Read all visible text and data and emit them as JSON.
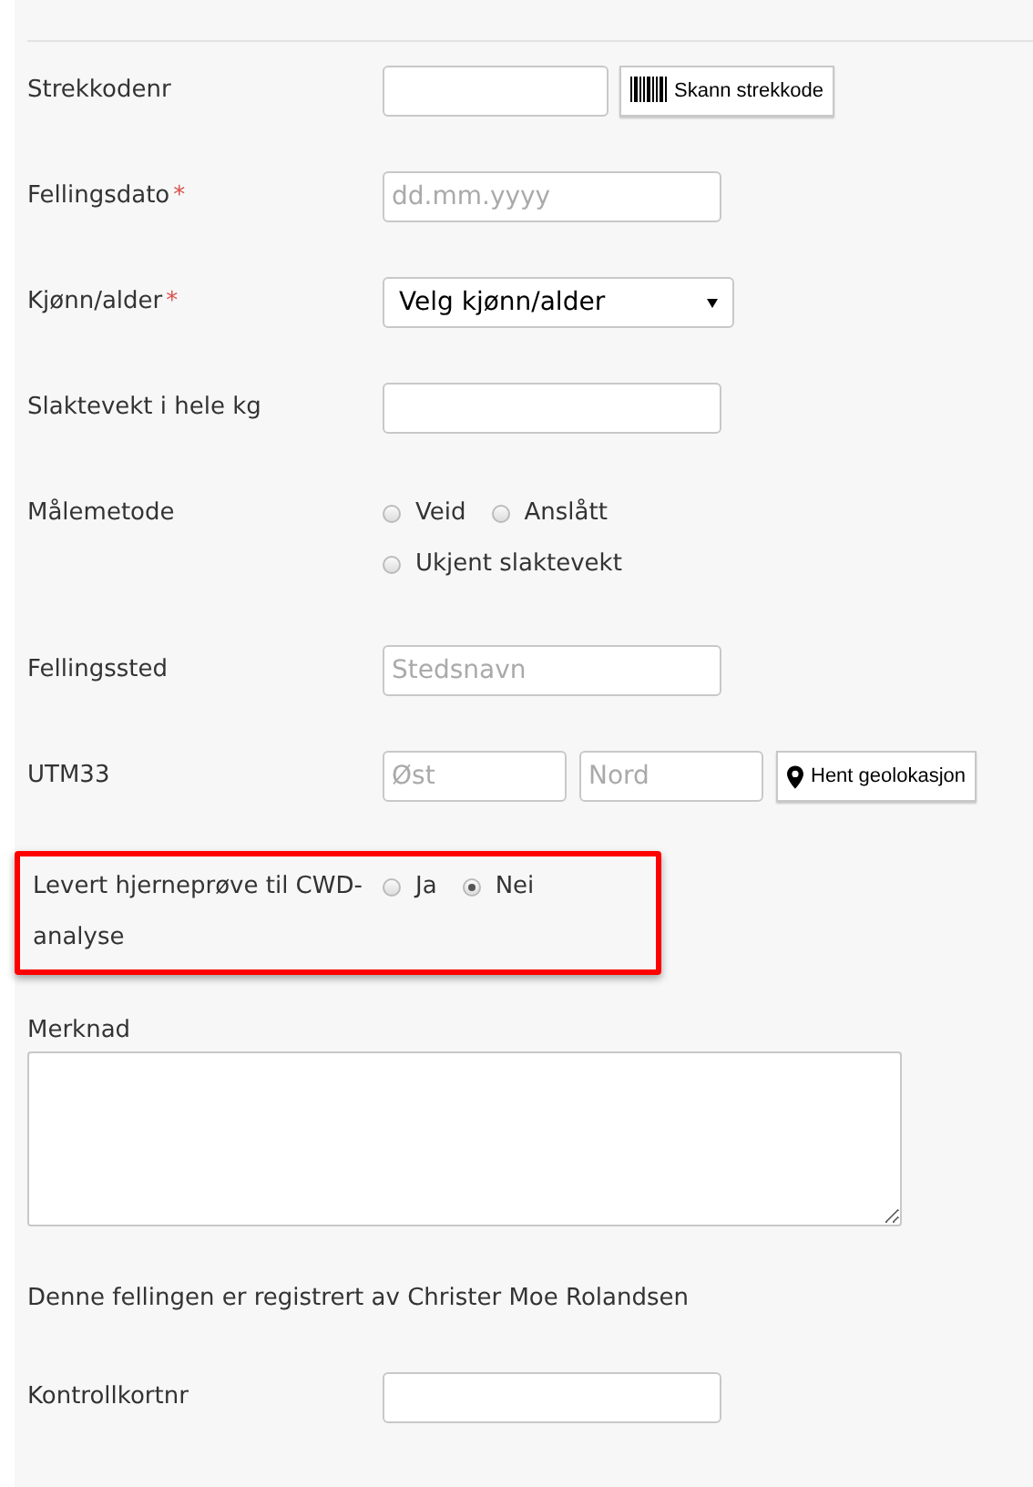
{
  "fields": [
    {
      "kind": "text",
      "label": "Strekkodenr",
      "button": "Skann strekkode"
    },
    {
      "kind": "text",
      "label": "Fellingsdato",
      "required_mark": "*",
      "placeholder": "dd.mm.yyyy"
    },
    {
      "kind": "select",
      "label": "Kjønn/alder",
      "required_mark": "*",
      "value": "Velg kjønn/alder"
    },
    {
      "kind": "text",
      "label": "Slaktevekt i hele kg"
    },
    {
      "kind": "radios",
      "label": "Målemetode",
      "options": [
        {
          "label": "Veid",
          "selected": false
        },
        {
          "label": "Anslått",
          "selected": false
        },
        {
          "label": "Ukjent slaktevekt",
          "selected": false
        }
      ]
    },
    {
      "kind": "text",
      "label": "Fellingssted",
      "placeholder": "Stedsnavn"
    },
    {
      "kind": "coords",
      "label": "UTM33",
      "placeholders": [
        "Øst",
        "Nord"
      ],
      "button": "Hent geolokasjon"
    },
    {
      "kind": "radios",
      "label": "Levert hjerneprøve til CWD-analyse",
      "highlighted": true,
      "options": [
        {
          "label": "Ja",
          "selected": false
        },
        {
          "label": "Nei",
          "selected": true
        }
      ]
    },
    {
      "kind": "textarea",
      "label": "Merknad"
    },
    {
      "kind": "note",
      "label": "Denne fellingen er registrert av Christer Moe Rolandsen"
    },
    {
      "kind": "text",
      "label": "Kontrollkortnr"
    }
  ]
}
